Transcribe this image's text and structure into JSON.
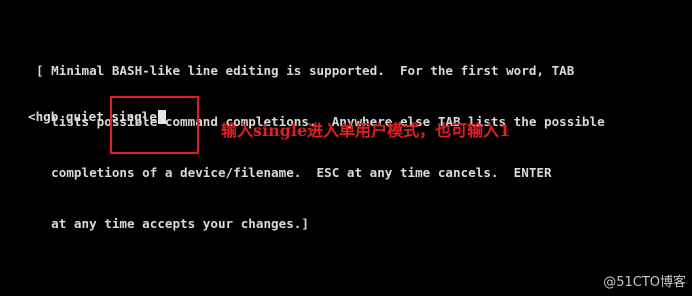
{
  "terminal": {
    "help_lines": [
      "[ Minimal BASH-like line editing is supported.  For the first word, TAB",
      "  lists possible command completions.  Anywhere else TAB lists the possible",
      "  completions of a device/filename.  ESC at any time cancels.  ENTER",
      "  at any time accepts your changes.]"
    ],
    "command_prefix": "<hgb quiet ",
    "command_typed": "single"
  },
  "annotation": {
    "text": "输入single进入单用户模式，也可输入1",
    "color": "#e02020"
  },
  "watermark": {
    "text": "@51CTO博客"
  },
  "colors": {
    "background": "#000000",
    "terminal_text": "#d9d9d9",
    "annotation_red": "#e02020"
  }
}
